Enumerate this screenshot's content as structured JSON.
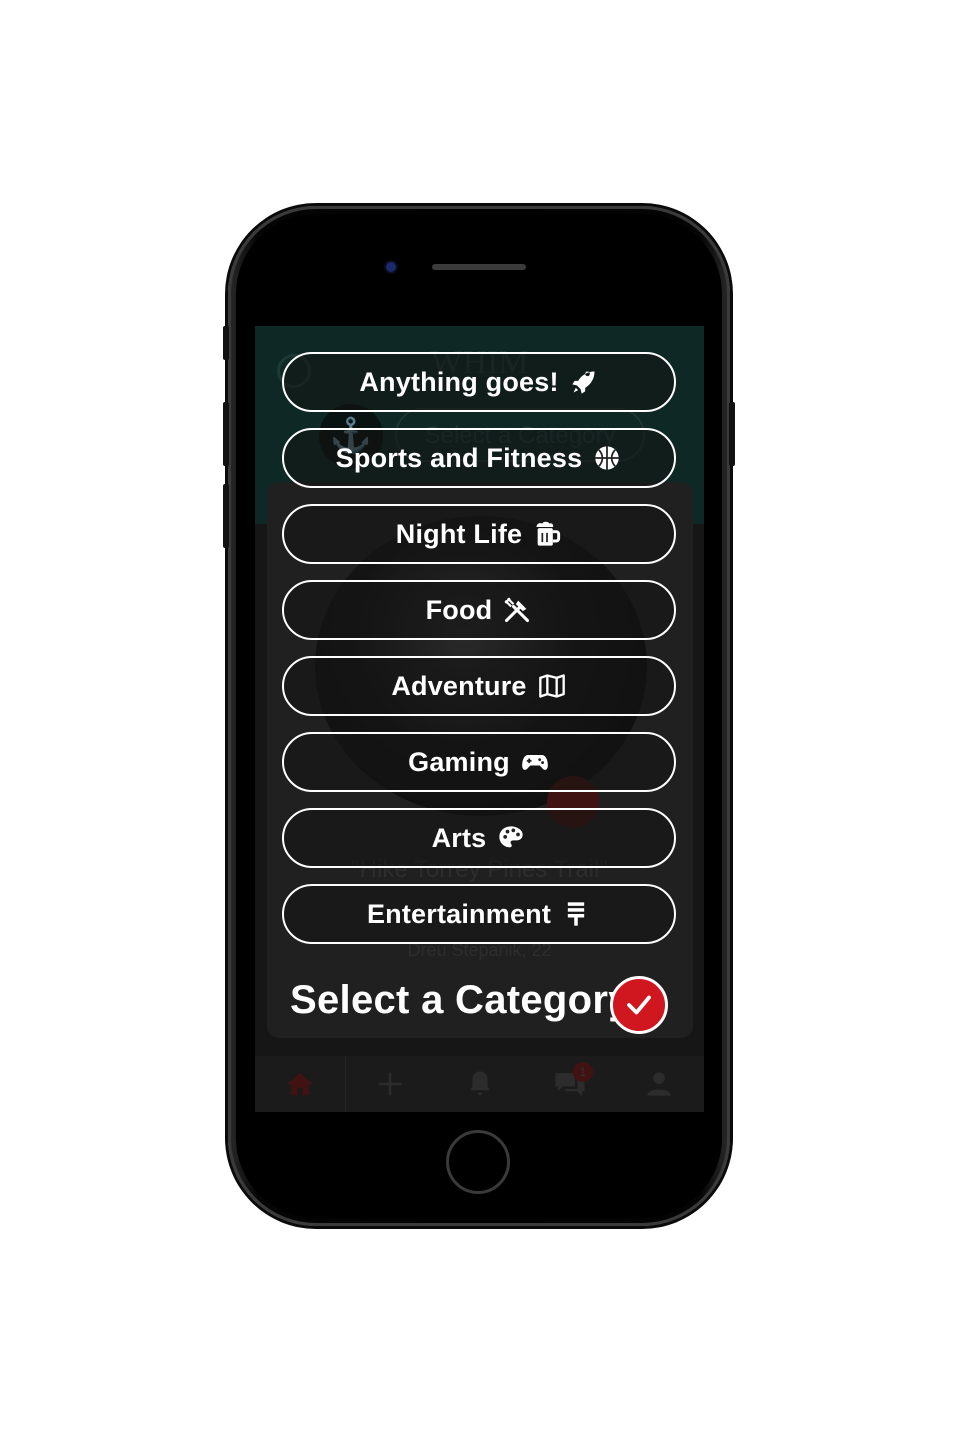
{
  "app": {
    "logo_text": "WHIM",
    "background_select": "Select a Category",
    "background_event_title": "\"Hike Torrey Pines Trail\"",
    "background_event_host": "Dreu Stepanik, 22",
    "notification_count": "1"
  },
  "categories": [
    {
      "label": "Anything goes!",
      "icon": "rocket-icon"
    },
    {
      "label": "Sports and Fitness",
      "icon": "basketball-icon"
    },
    {
      "label": "Night Life",
      "icon": "beer-mug-icon"
    },
    {
      "label": "Food",
      "icon": "utensils-icon"
    },
    {
      "label": "Adventure",
      "icon": "map-icon"
    },
    {
      "label": "Gaming",
      "icon": "gamepad-icon"
    },
    {
      "label": "Arts",
      "icon": "palette-icon"
    },
    {
      "label": "Entertainment",
      "icon": "microphone-icon"
    }
  ],
  "modal": {
    "title": "Select a Category",
    "confirm_icon": "check-circle-icon"
  },
  "tabbar": [
    "home-icon",
    "plus-icon",
    "bell-icon",
    "chat-icon",
    "user-icon"
  ],
  "colors": {
    "accent": "#d0161e",
    "header": "#123834",
    "button_border": "#ffffff"
  }
}
